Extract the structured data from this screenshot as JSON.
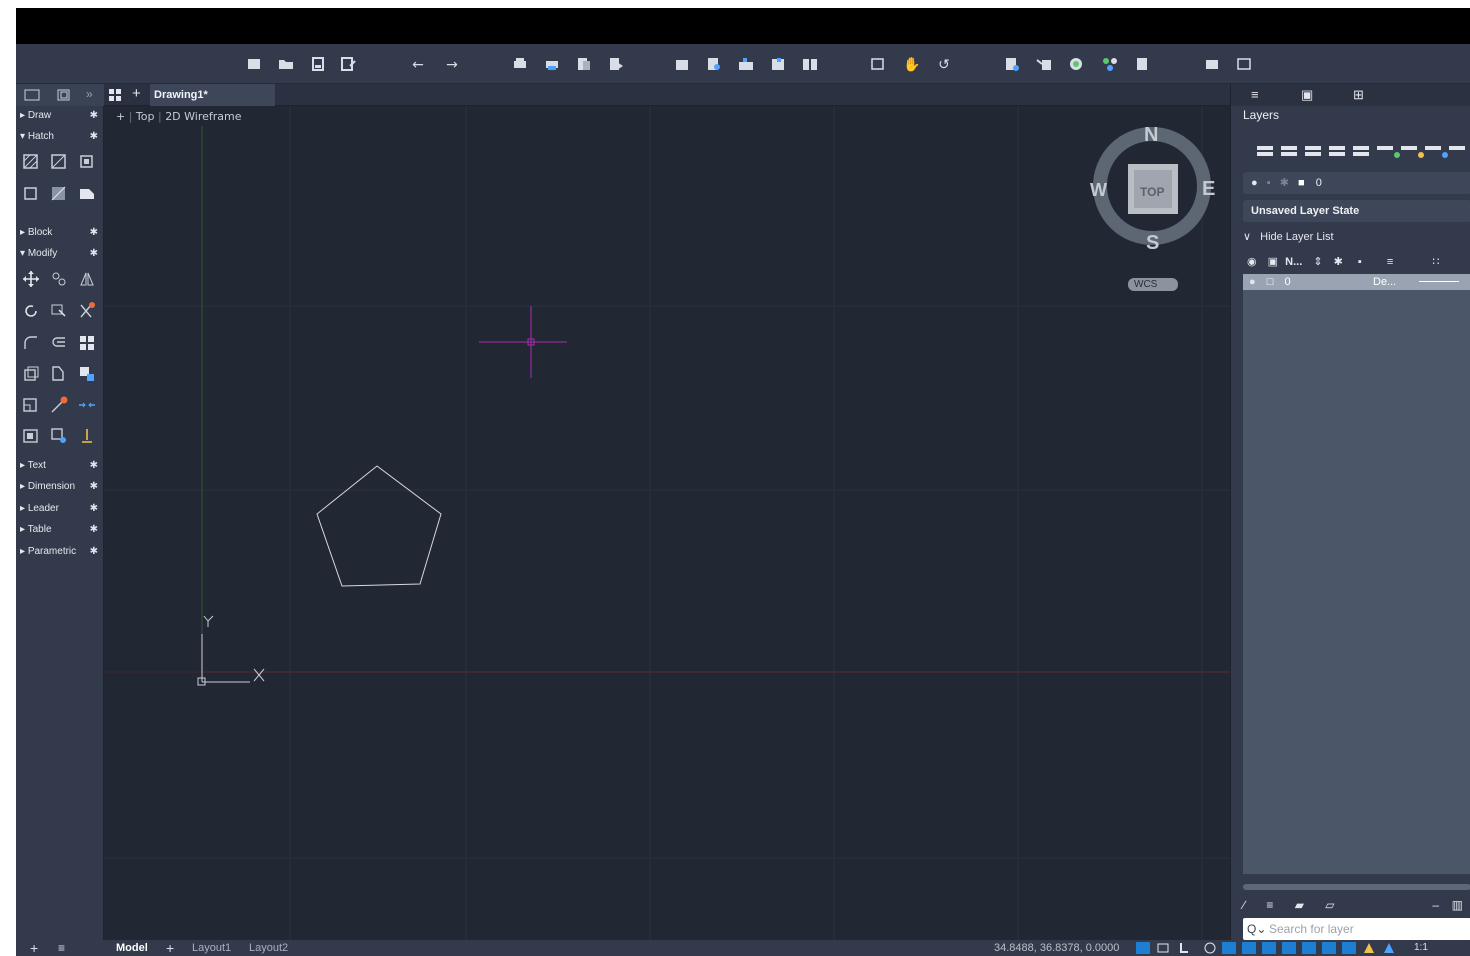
{
  "toolbar": {
    "icons": [
      "new-icon",
      "open-icon",
      "save-icon",
      "save-as-icon",
      "undo-icon",
      "redo-icon",
      "plot-icon",
      "batch-plot-icon",
      "publish-icon",
      "export-pdf-icon",
      "import-icon",
      "export-icon",
      "xref-icon",
      "attach-icon",
      "compare-icon",
      "zoom-window-icon",
      "pan-icon",
      "orbit-icon",
      "properties-icon",
      "match-icon",
      "purge-icon",
      "object-snap-icon",
      "share-icon",
      "workspace-icon",
      "layout-icon"
    ]
  },
  "tabs": {
    "document": "Drawing1*"
  },
  "palette": {
    "sections": [
      {
        "label": "Draw",
        "expanded": false
      },
      {
        "label": "Hatch",
        "expanded": true
      },
      {
        "label": "Block",
        "expanded": false
      },
      {
        "label": "Modify",
        "expanded": true
      },
      {
        "label": "Text",
        "expanded": false
      },
      {
        "label": "Dimension",
        "expanded": false
      },
      {
        "label": "Leader",
        "expanded": false
      },
      {
        "label": "Table",
        "expanded": false
      },
      {
        "label": "Parametric",
        "expanded": false
      }
    ]
  },
  "viewport": {
    "prefix": "+",
    "view": "Top",
    "style": "2D Wireframe",
    "viewcube": {
      "n": "N",
      "s": "S",
      "e": "E",
      "w": "W",
      "face": "TOP",
      "ucs": "WCS"
    },
    "axis_x": "X",
    "axis_y": "Y"
  },
  "layers": {
    "title": "Layers",
    "current_layer": "0",
    "state": "Unsaved Layer State",
    "toggle": "Hide Layer List",
    "columns": {
      "name": "N...",
      "linetype": "De..."
    },
    "rows": [
      {
        "name": "0",
        "linetype": "De..."
      }
    ],
    "search_placeholder": "Search for layer"
  },
  "statusbar": {
    "layout_tabs": [
      "Model",
      "Layout1",
      "Layout2"
    ],
    "coordinates": "34.8488, 36.8378, 0.0000",
    "scale": "1:1"
  },
  "colors": {
    "background": "#212733",
    "panel": "#323a4b",
    "crosshair": "#b02bb4",
    "accent": "#1e7fd2"
  }
}
